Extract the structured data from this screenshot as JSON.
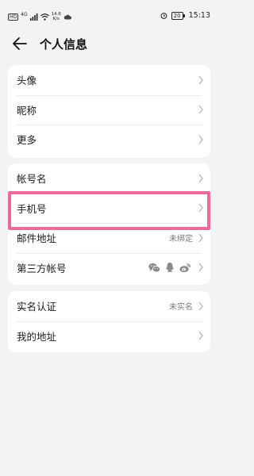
{
  "status_bar": {
    "hd": "HD",
    "net": "4G",
    "speed_value": "14.6",
    "speed_unit": "K/s",
    "battery": "20",
    "time": "15:13"
  },
  "header": {
    "title": "个人信息"
  },
  "card1": [
    {
      "label": "头像",
      "value": ""
    },
    {
      "label": "昵称",
      "value": ""
    },
    {
      "label": "更多",
      "value": ""
    }
  ],
  "card2": [
    {
      "label": "帐号名",
      "value": ""
    },
    {
      "label": "手机号",
      "value": ""
    },
    {
      "label": "邮件地址",
      "value": "未绑定"
    },
    {
      "label": "第三方帐号",
      "value": ""
    }
  ],
  "card3": [
    {
      "label": "实名认证",
      "value": "未实名"
    },
    {
      "label": "我的地址",
      "value": ""
    }
  ],
  "icons": {
    "back": "arrow-left-icon",
    "chevron": "chevron-right-icon",
    "social": [
      "wechat-icon",
      "qq-icon",
      "weibo-icon"
    ]
  },
  "colors": {
    "background": "#f1f3f5",
    "card": "#ffffff",
    "highlight": "#ec6a9c",
    "secondary_text": "#7a7a7a"
  }
}
